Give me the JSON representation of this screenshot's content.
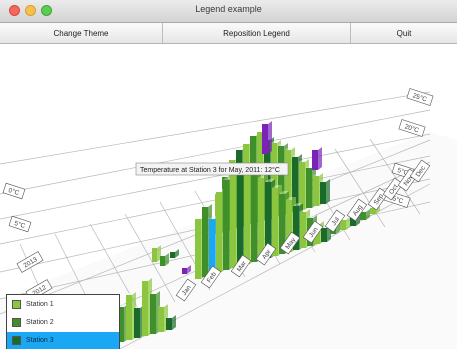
{
  "window": {
    "title": "Legend example"
  },
  "toolbar": {
    "buttons": [
      {
        "label": "Change Theme"
      },
      {
        "label": "Reposition Legend"
      },
      {
        "label": "Quit"
      }
    ]
  },
  "plot": {
    "tooltip": "Temperature at Station 3 for May, 2011: 12°C",
    "y_ticks": [
      "-5°C",
      "0°C",
      "5°C",
      "10°C",
      "15°C",
      "20°C",
      "25°C"
    ],
    "month_labels": [
      "Jan",
      "Feb",
      "Mar",
      "Apr",
      "May",
      "Jun",
      "Jul",
      "Aug",
      "Sep",
      "Oct",
      "Nov",
      "Dec"
    ],
    "year_labels": [
      "2013",
      "2012",
      "2011",
      "2010"
    ],
    "colors": {
      "station_1": "#8cc63f",
      "station_2": "#3f8f2a",
      "station_3": "#1a6b2a",
      "station_3_selected": "#1aa8f5",
      "highlight": "#7b22b8"
    }
  },
  "legend": {
    "items": [
      {
        "label": "Station 1",
        "color": "#8cc63f",
        "selected": false
      },
      {
        "label": "Station 2",
        "color": "#3f8f2a",
        "selected": false
      },
      {
        "label": "Station 3",
        "color": "#1a6b2a",
        "selected": true
      }
    ]
  }
}
